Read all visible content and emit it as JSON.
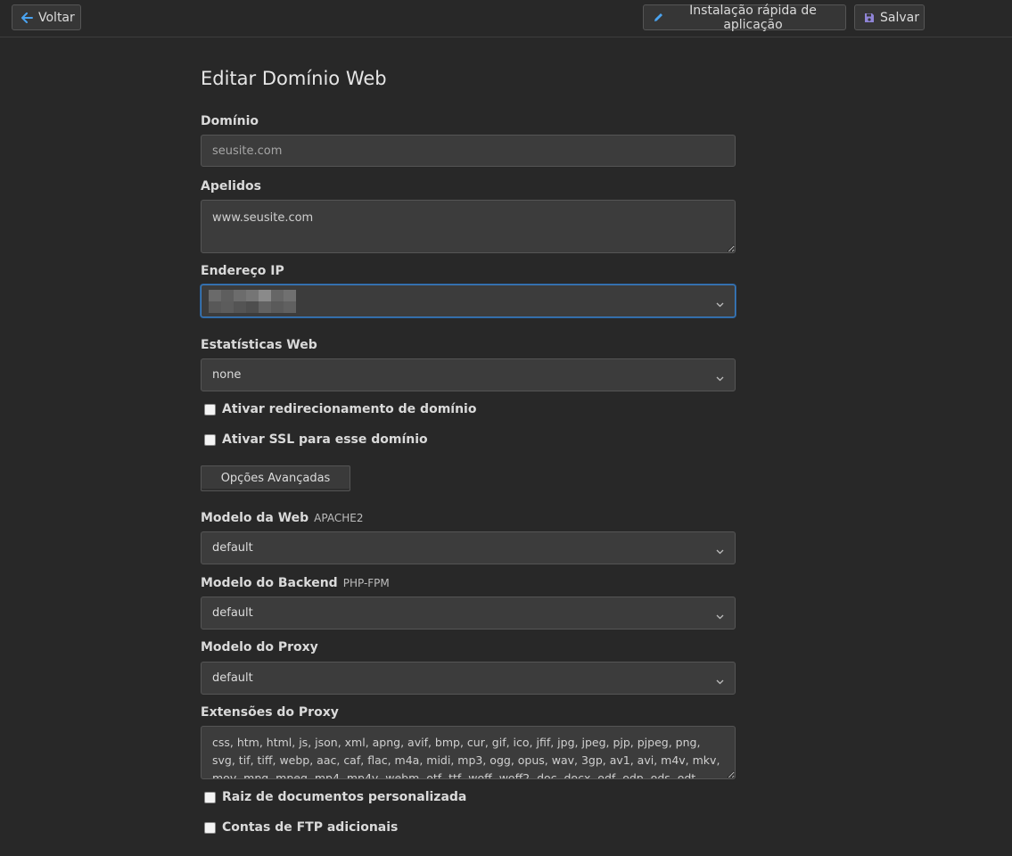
{
  "toolbar": {
    "back_label": "Voltar",
    "quick_install_label": "Instalação rápida de aplicação",
    "save_label": "Salvar"
  },
  "form": {
    "title": "Editar Domínio Web",
    "domain": {
      "label": "Domínio",
      "placeholder": "seusite.com"
    },
    "aliases": {
      "label": "Apelidos",
      "value": "www.seusite.com"
    },
    "ip": {
      "label": "Endereço IP"
    },
    "stats": {
      "label": "Estatísticas Web",
      "value": "none"
    },
    "redirect": {
      "label": "Ativar redirecionamento de domínio",
      "checked": false
    },
    "ssl": {
      "label": "Ativar SSL para esse domínio",
      "checked": false
    },
    "advanced_label": "Opções Avançadas",
    "web_template": {
      "label": "Modelo da Web",
      "sub": "APACHE2",
      "value": "default"
    },
    "backend_template": {
      "label": "Modelo do Backend",
      "sub": "PHP-FPM",
      "value": "default"
    },
    "proxy_template": {
      "label": "Modelo do Proxy",
      "value": "default"
    },
    "proxy_ext": {
      "label": "Extensões do Proxy",
      "value": "css, htm, html, js, json, xml, apng, avif, bmp, cur, gif, ico, jfif, jpg, jpeg, pjp, pjpeg, png, svg, tif, tiff, webp, aac, caf, flac, m4a, midi, mp3, ogg, opus, wav, 3gp, av1, avi, m4v, mkv, mov, mpg, mpeg, mp4, mp4v, webm, otf, ttf, woff, woff2, doc, docx, odf, odp, ods, odt, pdf, ppt, pptx, rtf, txt, xls, xlsx"
    },
    "custom_docroot": {
      "label": "Raiz de documentos personalizada",
      "checked": false
    },
    "ftp_accounts": {
      "label": "Contas de FTP adicionais",
      "checked": false
    }
  },
  "colors": {
    "background": "#282828",
    "accent_blue": "#3b7fc4",
    "save_icon": "#8f84d6"
  },
  "icons": {
    "back": "arrow-left-icon",
    "quick_install": "pencil-icon",
    "save": "floppy-disk-icon",
    "select": "chevron-down-icon"
  }
}
